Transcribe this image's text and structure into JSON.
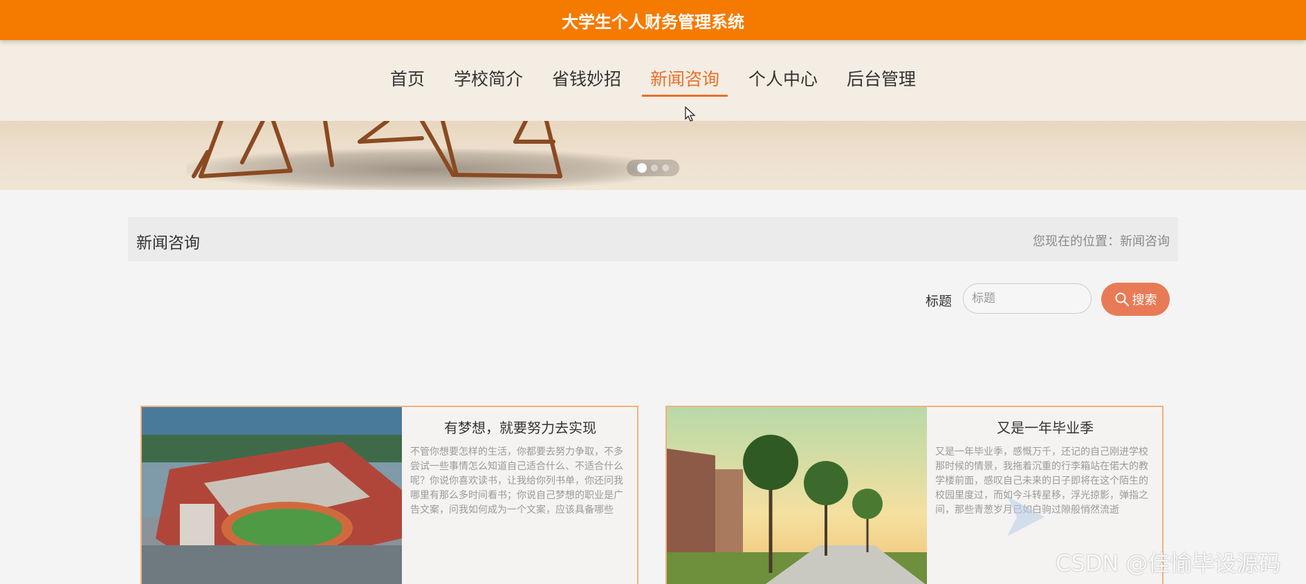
{
  "header": {
    "title": "大学生个人财务管理系统"
  },
  "nav": {
    "items": [
      {
        "label": "首页"
      },
      {
        "label": "学校简介"
      },
      {
        "label": "省钱妙招"
      },
      {
        "label": "新闻咨询"
      },
      {
        "label": "个人中心"
      },
      {
        "label": "后台管理"
      }
    ],
    "active_index": 3
  },
  "carousel": {
    "slide_count": 3,
    "active_slide": 1
  },
  "breadcrumb": {
    "title": "新闻咨询",
    "path": "您现在的位置：新闻咨询"
  },
  "search": {
    "label": "标题",
    "placeholder": "标题",
    "button_label": "搜索"
  },
  "news": [
    {
      "title": "有梦想，就要努力去实现",
      "excerpt": "不管你想要怎样的生活，你都要去努力争取，不多尝试一些事情怎么知道自己适合什么、不适合什么呢？你说你喜欢读书，让我给你列书单，你还问我哪里有那么多时间看书；你说自己梦想的职业是广告文案，问我如何成为一个文案，应该具备哪些"
    },
    {
      "title": "又是一年毕业季",
      "excerpt": "又是一年毕业季，感慨万千，还记的自己刚进学校那时候的情景，我拖着沉重的行李箱站在偌大的教学楼前面，感叹自己未来的日子即将在这个陌生的校园里度过，而如今斗转星移，浮光掠影，弹指之间，那些青葱岁月已如白驹过隙般悄然流逝"
    }
  ],
  "watermark": "CSDN @佳愉毕设源码",
  "colors": {
    "header": "#f57a00",
    "accent": "#e8702a",
    "button": "#e87b56"
  }
}
